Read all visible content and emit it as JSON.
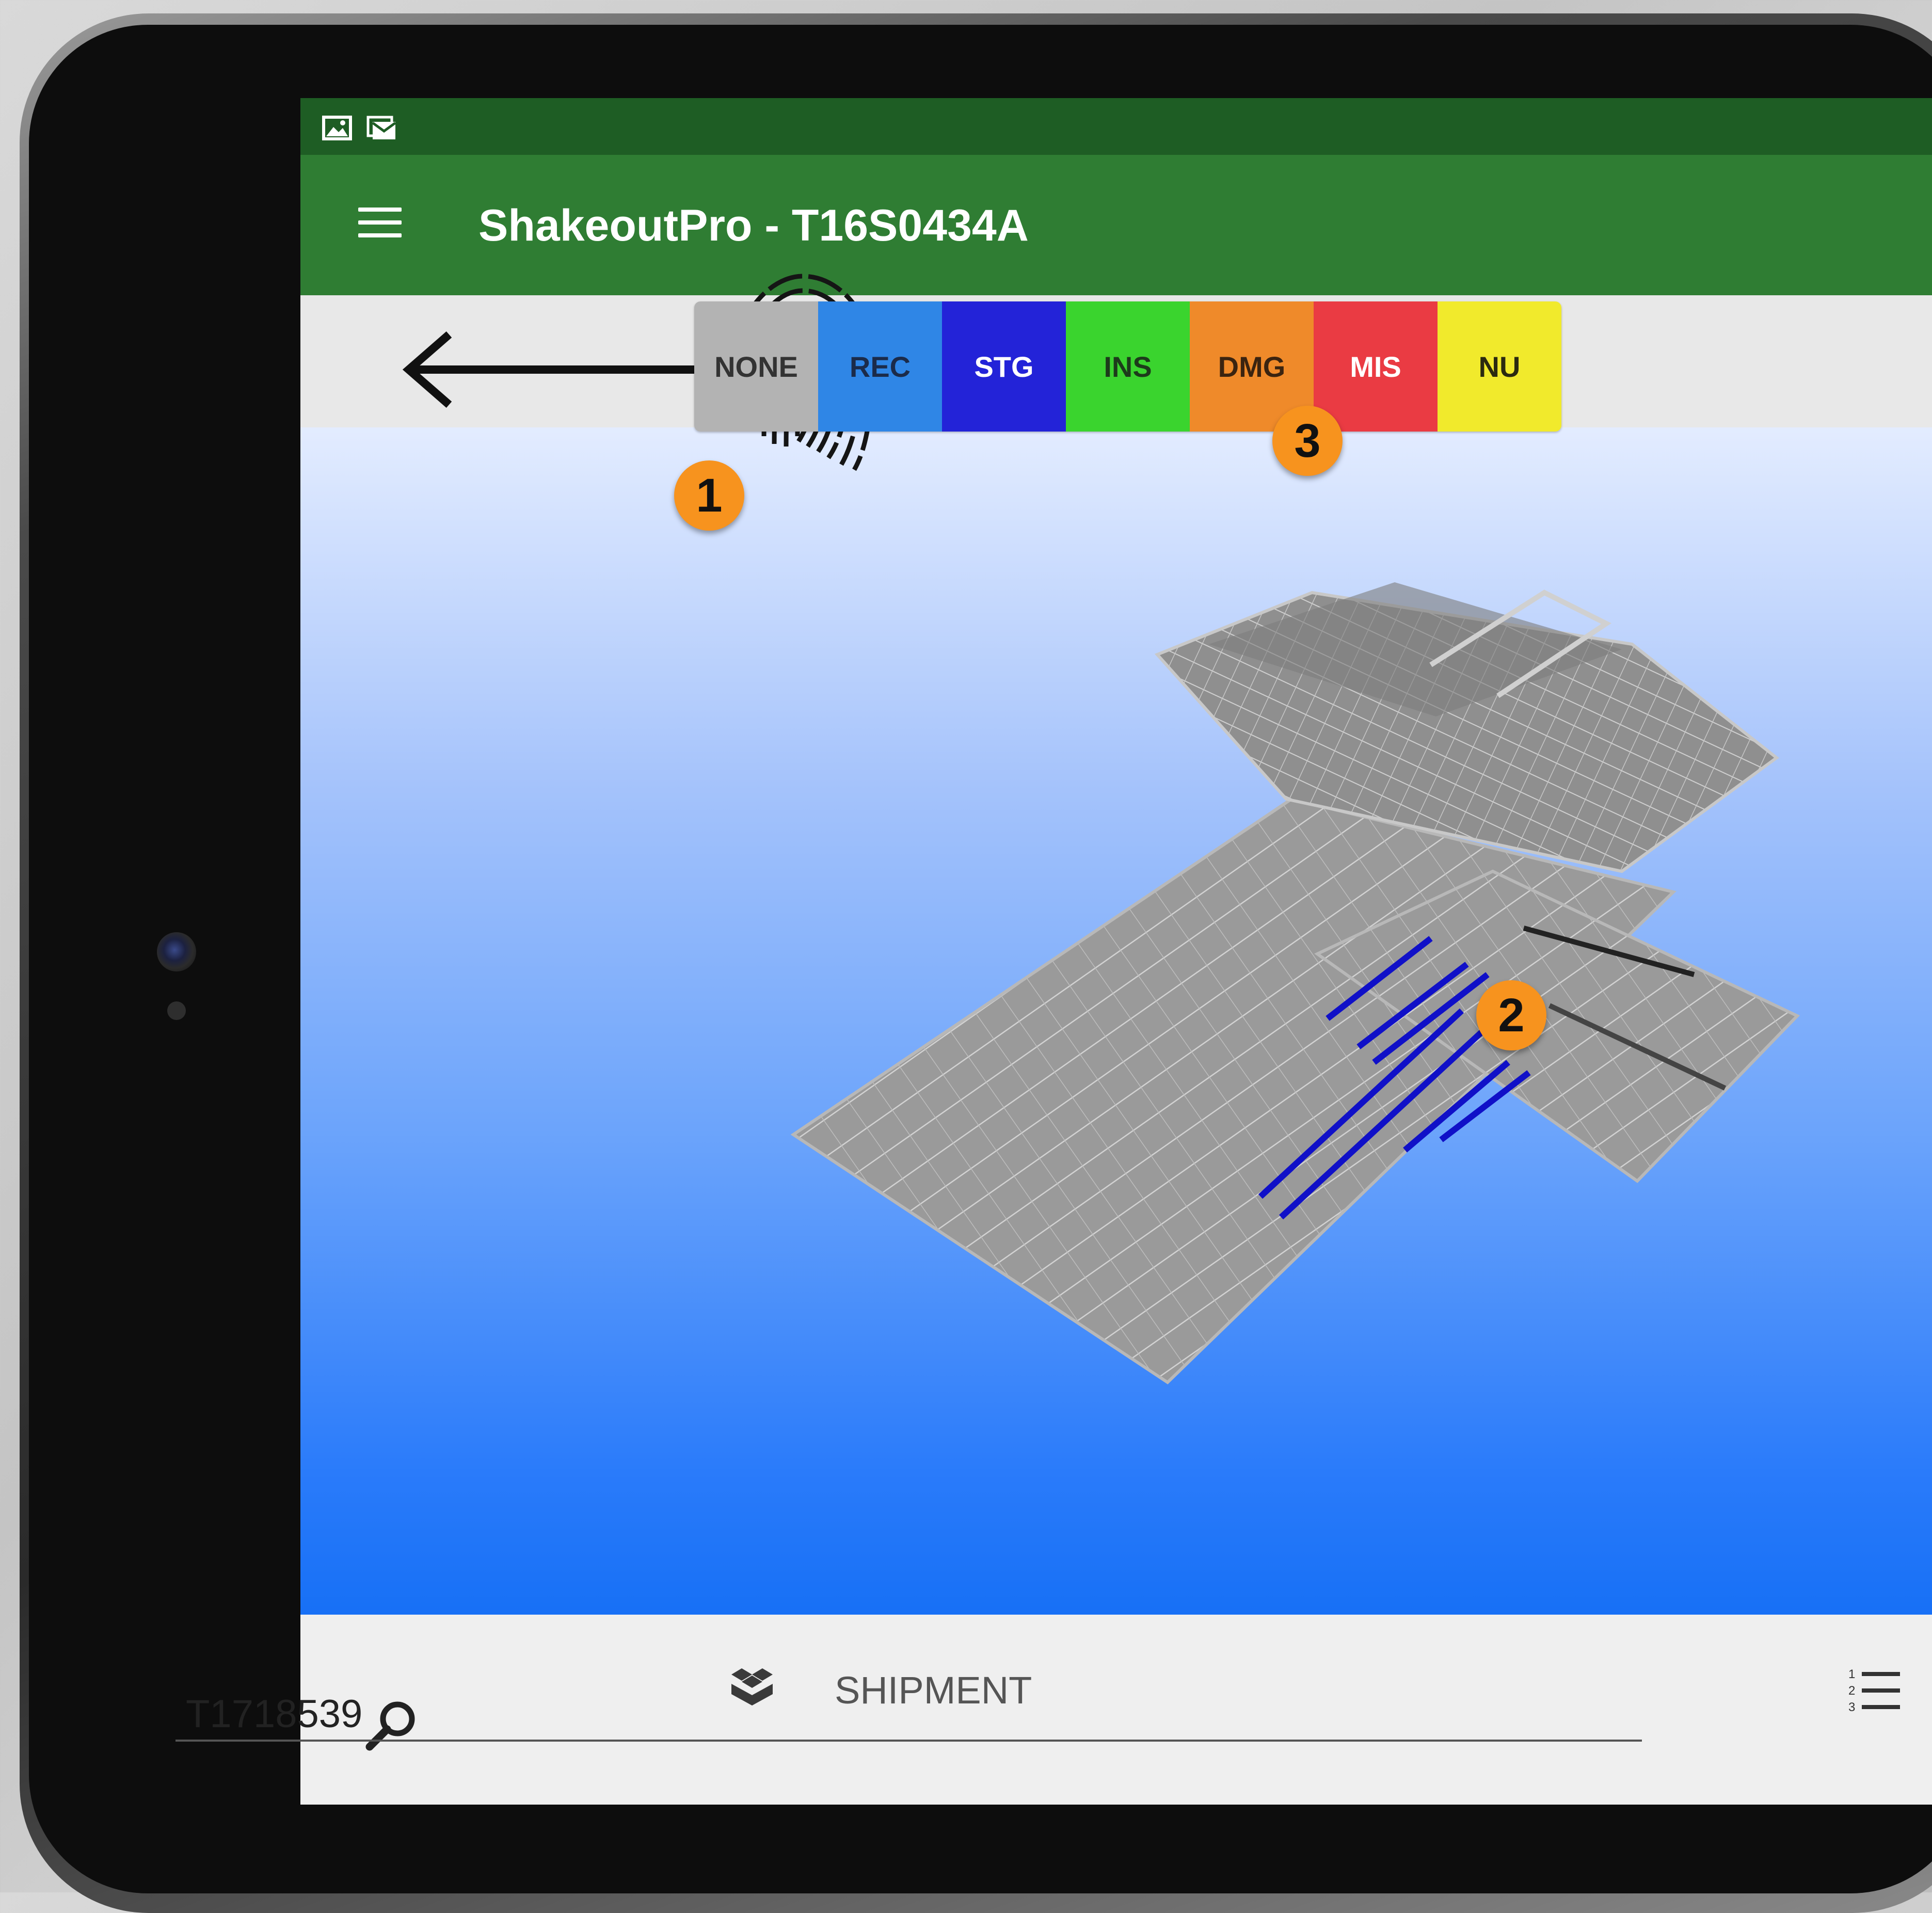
{
  "app_bar": {
    "title": "ShakeoutPro - T16S0434A"
  },
  "status_bar": {
    "icons": [
      "image-notification-icon",
      "mail-notification-icon"
    ]
  },
  "toolbar": {
    "back_icon": "arrow-left-icon",
    "fingerprint_icon": "fingerprint-icon"
  },
  "status_filters": [
    {
      "label": "NONE",
      "bg": "#b3b3b3",
      "fg": "#333333"
    },
    {
      "label": "REC",
      "bg": "#2f86e6",
      "fg": "#1b2b4a"
    },
    {
      "label": "STG",
      "bg": "#2323d8",
      "fg": "#ffffff"
    },
    {
      "label": "INS",
      "bg": "#3ad42e",
      "fg": "#1d3b1b"
    },
    {
      "label": "DMG",
      "bg": "#ef8a2a",
      "fg": "#3b2410"
    },
    {
      "label": "MIS",
      "bg": "#ea3b43",
      "fg": "#ffffff"
    },
    {
      "label": "NU",
      "bg": "#f1ea2c",
      "fg": "#2b2a10"
    }
  ],
  "bottom_panel": {
    "shipment_label": "SHIPMENT",
    "search_value": "T1718539",
    "shipment_icon": "boxes-icon",
    "list_icon": "numbered-list-icon",
    "search_icon": "search-icon"
  },
  "callouts": [
    "1",
    "2",
    "3"
  ],
  "colors": {
    "status_bar": "#1e5d24",
    "app_bar": "#2f7d33",
    "callout": "#f7931e",
    "highlight_members": "#1010c8"
  }
}
